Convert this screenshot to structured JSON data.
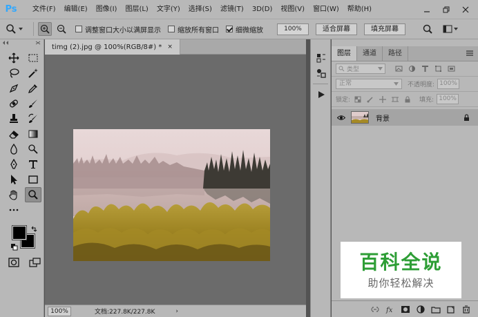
{
  "app": {
    "logo": "Ps"
  },
  "menu": [
    "文件(F)",
    "编辑(E)",
    "图像(I)",
    "图层(L)",
    "文字(Y)",
    "选择(S)",
    "滤镜(T)",
    "3D(D)",
    "视图(V)",
    "窗口(W)",
    "帮助(H)"
  ],
  "options": {
    "resize_windows_label": "调整窗口大小以满屏显示",
    "zoom_all_label": "缩放所有窗口",
    "scrubby_label": "细微缩放",
    "zoom_value": "100%",
    "fit_screen": "适合屏幕",
    "fill_screen": "填充屏幕",
    "resize_windows_checked": false,
    "zoom_all_checked": false,
    "scrubby_checked": true
  },
  "document": {
    "tab_title": "timg (2).jpg @ 100%(RGB/8#) *",
    "tab_close": "×",
    "status_zoom": "100%",
    "status_info": "文档:227.8K/227.8K",
    "status_arrow": "›"
  },
  "layers_panel": {
    "tabs": [
      "图层",
      "通道",
      "路径"
    ],
    "kind_label": "类型",
    "blend_mode": "正常",
    "opacity_label": "不透明度:",
    "opacity_value": "100%",
    "lock_label": "锁定:",
    "fill_label": "填充:",
    "fill_value": "100%",
    "layer_name": "背景"
  },
  "watermark": {
    "title": "百科全说",
    "subtitle": "助你轻松解决"
  },
  "colors": {
    "ps_blue": "#31a8ff",
    "watermark_green": "#2e9e36"
  }
}
